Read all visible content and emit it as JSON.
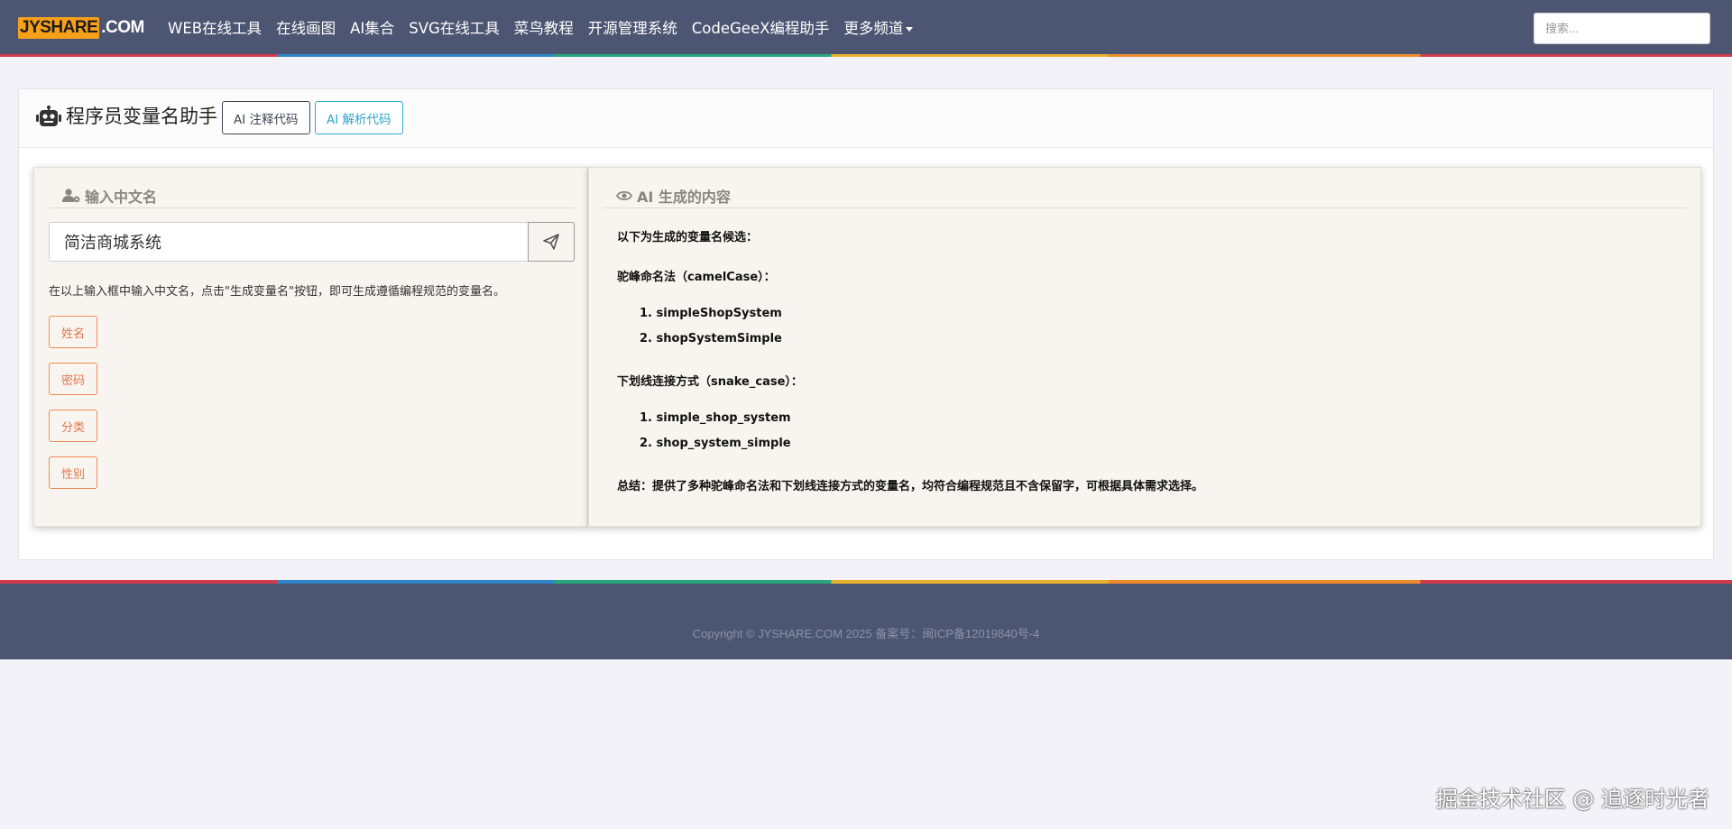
{
  "brand": {
    "logo_main": "JYSHARE",
    "logo_suffix": ".COM",
    "accent": "#f7a01b",
    "nav_bg": "#4c5571"
  },
  "nav": {
    "links": [
      "WEB在线工具",
      "在线画图",
      "AI集合",
      "SVG在线工具",
      "菜鸟教程",
      "开源管理系统",
      "CodeGeeX编程助手",
      "更多频道"
    ],
    "search_placeholder": "搜索..."
  },
  "card": {
    "title": "程序员变量名助手",
    "btn_annotate": "AI 注释代码",
    "btn_parse": "AI 解析代码"
  },
  "left_panel": {
    "heading": "输入中文名",
    "input_value": "简洁商城系统",
    "hint": "在以上输入框中输入中文名，点击\"生成变量名\"按钮，即可生成遵循编程规范的变量名。",
    "tags": [
      "姓名",
      "密码",
      "分类",
      "性别"
    ]
  },
  "right_panel": {
    "heading": "AI 生成的内容",
    "intro": "以下为生成的变量名候选：",
    "camel_title": "驼峰命名法（camelCase）：",
    "camel_items": [
      "simpleShopSystem",
      "shopSystemSimple"
    ],
    "snake_title": "下划线连接方式（snake_case）：",
    "snake_items": [
      "simple_shop_system",
      "shop_system_simple"
    ],
    "summary": "总结：提供了多种驼峰命名法和下划线连接方式的变量名，均符合编程规范且不含保留字，可根据具体需求选择。"
  },
  "footer": {
    "copyright": "Copyright © JYSHARE.COM 2025 备案号：闽ICP备12019840号-4"
  },
  "watermark": "掘金技术社区 @ 追逐时光者"
}
